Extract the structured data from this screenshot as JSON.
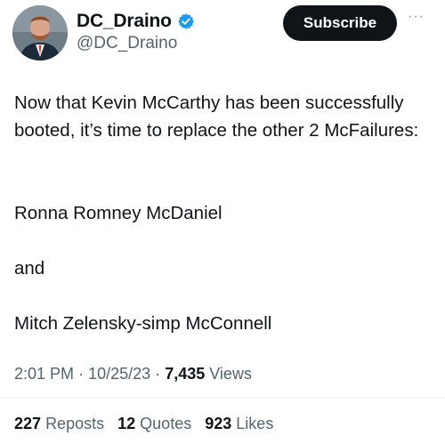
{
  "author": {
    "display_name": "DC_Draino",
    "handle": "@DC_Draino",
    "verified_icon": "verified-badge-icon",
    "avatar_icon": "profile-avatar"
  },
  "actions": {
    "subscribe_label": "Subscribe",
    "more_label": "···"
  },
  "tweet": {
    "paragraphs": [
      "Now that Kevin McCarthy has been successfully booted, it’s time to replace the other 2 McFailures:",
      "Ronna Romney McDaniel",
      "and",
      "Mitch Zelensky-simp McConnell"
    ]
  },
  "meta": {
    "time": "2:01 PM",
    "date": "10/25/23",
    "sep": "·",
    "views_count": "7,435",
    "views_label": "Views"
  },
  "stats": {
    "reposts_count": "227",
    "reposts_label": "Reposts",
    "quotes_count": "12",
    "quotes_label": "Quotes",
    "likes_count": "923",
    "likes_label": "Likes"
  },
  "colors": {
    "text": "#0f1419",
    "secondary": "#536471",
    "verified_blue": "#1d9bf0",
    "button_bg": "#0f1419"
  }
}
